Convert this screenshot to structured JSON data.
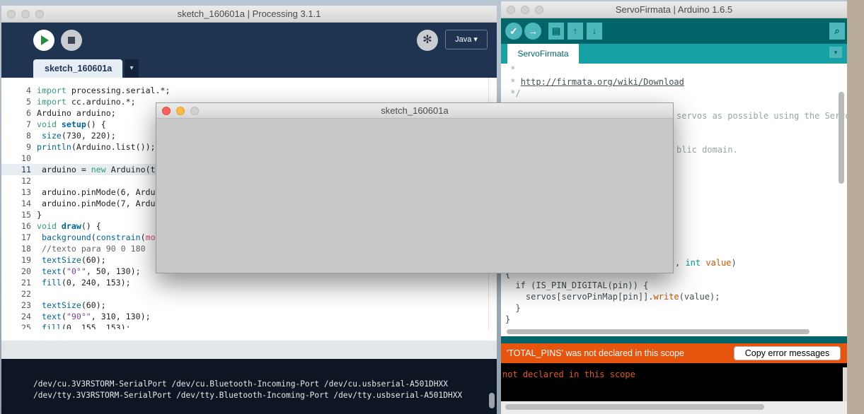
{
  "processing": {
    "title": "sketch_160601a | Processing 3.1.1",
    "mode": "Java ▾",
    "tab_label": "sketch_160601a",
    "tab_menu": "▾",
    "code_lines": [
      {
        "n": "4",
        "t": "import processing.serial.*;"
      },
      {
        "n": "5",
        "t": "import cc.arduino.*;"
      },
      {
        "n": "6",
        "t": "Arduino arduino;"
      },
      {
        "n": "7",
        "t": "void setup() {"
      },
      {
        "n": "8",
        "t": " size(730, 220);"
      },
      {
        "n": "9",
        "t": "println(Arduino.list());"
      },
      {
        "n": "10",
        "t": ""
      },
      {
        "n": "11",
        "t": " arduino = new Arduino(t"
      },
      {
        "n": "12",
        "t": ""
      },
      {
        "n": "13",
        "t": " arduino.pinMode(6, Ardu"
      },
      {
        "n": "14",
        "t": " arduino.pinMode(7, Ardu"
      },
      {
        "n": "15",
        "t": "}"
      },
      {
        "n": "16",
        "t": "void draw() {"
      },
      {
        "n": "17",
        "t": " background(constrain(mo"
      },
      {
        "n": "18",
        "t": " //texto para 90 0 180"
      },
      {
        "n": "19",
        "t": " textSize(60);"
      },
      {
        "n": "20",
        "t": " text(\"0°\", 50, 130);"
      },
      {
        "n": "21",
        "t": " fill(0, 240, 153);"
      },
      {
        "n": "22",
        "t": ""
      },
      {
        "n": "23",
        "t": " textSize(60);"
      },
      {
        "n": "24",
        "t": " text(\"90°\", 310, 130);"
      },
      {
        "n": "25",
        "t": " fill(0, 155, 153);"
      }
    ],
    "console_lines": [
      "/dev/cu.3V3RSTORM-SerialPort /dev/cu.Bluetooth-Incoming-Port /dev/cu.usbserial-A501DHXX",
      "/dev/tty.3V3RSTORM-SerialPort /dev/tty.Bluetooth-Incoming-Port /dev/tty.usbserial-A501DHXX"
    ]
  },
  "arduino": {
    "title": "ServoFirmata | Arduino 1.6.5",
    "tab_label": "ServoFirmata",
    "tab_menu": "▾",
    "toolbar": {
      "verify": "✓",
      "upload": "→",
      "new": "▤",
      "open": "↑",
      "save": "↓",
      "serial": "⌕"
    },
    "code": {
      "l1": " *",
      "l2_prefix": " * ",
      "l2_link": "http://firmata.org/wiki/Download",
      "l3": " */",
      "l4": "servos as possible using the Servo",
      "l5": "blic domain.",
      "l6_kw": "int",
      "l6_var": "value",
      "l6_end": ")",
      "l7": "{",
      "l8": "  if (IS_PIN_DIGITAL(pin)) {",
      "l9_a": "    servos[servoPinMap[pin]].",
      "l9_fn": "write",
      "l9_b": "(value);",
      "l10": "  }",
      "l11": "}"
    },
    "error_message": "'TOTAL_PINS' was not declared in this scope",
    "copy_button": "Copy error messages",
    "console_text": "not declared in this scope"
  },
  "sketch_window": {
    "title": "sketch_160601a"
  },
  "colors": {
    "processing_bg": "#1f3450",
    "arduino_teal": "#006468",
    "error_orange": "#e6540d"
  }
}
